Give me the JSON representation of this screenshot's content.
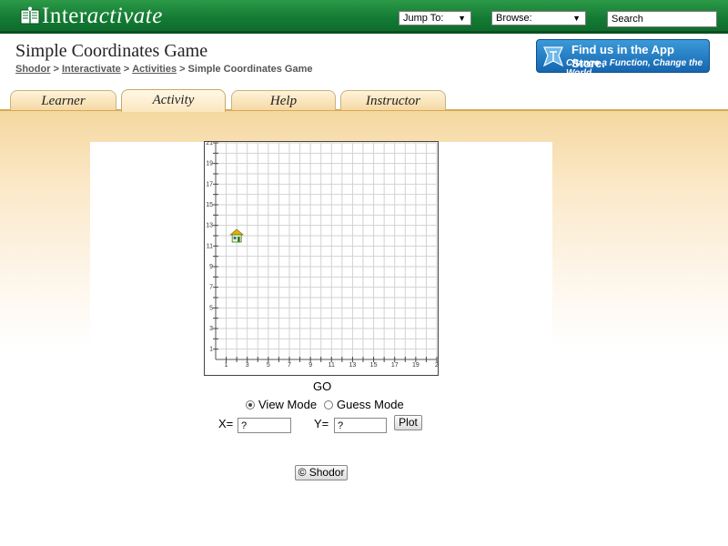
{
  "header": {
    "logo_prefix": "Inter",
    "logo_suffix": "activate",
    "jump_to": "Jump To:",
    "browse": "Browse:",
    "search": "Search",
    "colors": {
      "bar": "#137a33",
      "accent": "#f5d9a4"
    }
  },
  "page": {
    "title": "Simple Coordinates Game",
    "breadcrumb": [
      "Shodor",
      "Interactivate",
      "Activities",
      "Simple Coordinates Game"
    ],
    "breadcrumb_sep": ">"
  },
  "app_store": {
    "line1": "Find us in the App Store.",
    "line2": "Change a Function, Change the World",
    "icon": "app-store-icon"
  },
  "tabs": [
    {
      "label": "Learner",
      "active": false
    },
    {
      "label": "Activity",
      "active": true
    },
    {
      "label": "Help",
      "active": false
    },
    {
      "label": "Instructor",
      "active": false
    }
  ],
  "game": {
    "grid": {
      "xmin": 0,
      "xmax": 21,
      "ymin": 0,
      "ymax": 21
    },
    "x_tick_labels": [
      "1",
      "3",
      "5",
      "7",
      "9",
      "11",
      "13",
      "15",
      "17",
      "19",
      "2"
    ],
    "y_tick_labels": [
      "21",
      "19",
      "17",
      "15",
      "13",
      "11",
      "9",
      "7",
      "5",
      "3",
      "1"
    ],
    "house_position": {
      "x": 2,
      "y": 12
    },
    "house_icon": "house-icon",
    "go_label": "GO",
    "modes": [
      {
        "label": "View Mode",
        "selected": true
      },
      {
        "label": "Guess Mode",
        "selected": false
      }
    ],
    "x_label": "X=",
    "x_value": "?",
    "y_label": "Y=",
    "y_value": "?",
    "plot_label": "Plot"
  },
  "footer": {
    "shodor_button": "© Shodor"
  }
}
